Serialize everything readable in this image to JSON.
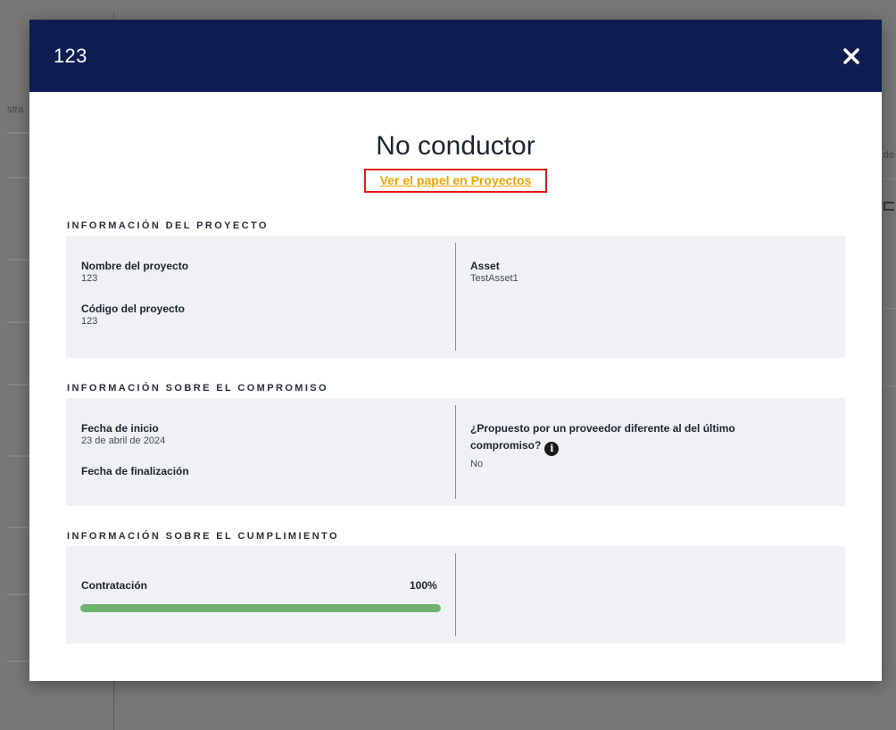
{
  "background": {
    "left_partial_text": "stra",
    "right_partial_text": "do"
  },
  "modal": {
    "title": "123",
    "close_icon": "close-icon",
    "role_title": "No conductor",
    "role_link": "Ver el papel en Proyectos",
    "sections": {
      "project": {
        "heading": "INFORMACIÓN DEL PROYECTO",
        "name_label": "Nombre del proyecto",
        "name_value": "123",
        "code_label": "Código del proyecto",
        "code_value": "123",
        "asset_label": "Asset",
        "asset_value": "TestAsset1"
      },
      "engagement": {
        "heading": "INFORMACIÓN SOBRE EL COMPROMISO",
        "start_label": "Fecha de inicio",
        "start_value": "23 de abril de 2024",
        "end_label": "Fecha de finalización",
        "supplier_question_line1": "¿Propuesto por un proveedor diferente al del último",
        "supplier_question_line2": "compromiso?",
        "supplier_value": "No",
        "info_icon": "info-icon"
      },
      "compliance": {
        "heading": "INFORMACIÓN SOBRE EL CUMPLIMIENTO",
        "hiring_label": "Contratación",
        "hiring_percent_text": "100%",
        "hiring_progress": 1.0
      }
    }
  },
  "colors": {
    "header_bg": "#0d1c51",
    "link": "#f0a400",
    "highlight_border": "#e0191c",
    "progress": "#6db26d",
    "panel_bg": "#eff1f4"
  }
}
